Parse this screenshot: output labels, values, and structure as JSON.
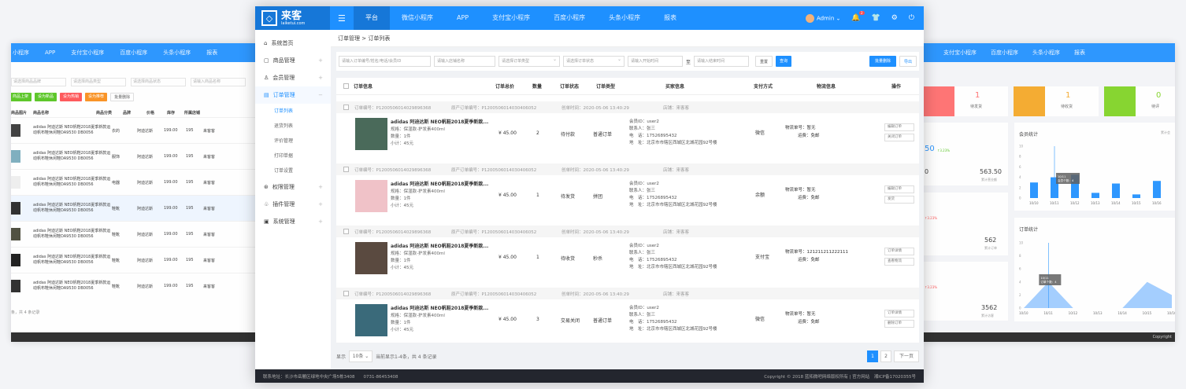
{
  "bg_left": {
    "nav": [
      "小程序",
      "APP",
      "支付宝小程序",
      "百度小程序",
      "头条小程序",
      "报表"
    ],
    "filters": [
      "请选择商品品牌",
      "请选择商品类型",
      "请选择商品状态",
      "请输入商品名称"
    ],
    "buttons": [
      {
        "label": "商品上架",
        "color": "#52c41a"
      },
      {
        "label": "设为新品",
        "color": "#52c41a"
      },
      {
        "label": "设为热销",
        "color": "#ff4d4f"
      },
      {
        "label": "设为推荐",
        "color": "#fa8c16"
      },
      {
        "label": "批量删除",
        "color": "#ffffff"
      }
    ],
    "headers": [
      "商品图片",
      "商品名称",
      "商品分类",
      "品牌",
      "价格",
      "库存",
      "所属店铺"
    ],
    "rows": [
      {
        "name": "adidas 阿迪达斯 NEO帆鞋2018夏季新款运动帆布鞋休闲鞋DA9530 DB0056",
        "cat": "衣的",
        "brand": "阿迪达斯",
        "price": "199.00",
        "stock": "195",
        "shop": "来客客"
      },
      {
        "name": "adidas 阿迪达斯 NEO帆鞋2018夏季新款运动帆布鞋休闲鞋DA9530 DB0056",
        "cat": "服饰",
        "brand": "阿迪达斯",
        "price": "199.00",
        "stock": "195",
        "shop": "来客客"
      },
      {
        "name": "adidas 阿迪达斯 NEO帆鞋2018夏季新款运动帆布鞋休闲鞋DA9530 DB0056",
        "cat": "电器",
        "brand": "阿迪达斯",
        "price": "199.00",
        "stock": "195",
        "shop": "来客客"
      },
      {
        "name": "adidas 阿迪达斯 NEO帆鞋2018夏季新款运动帆布鞋休闲鞋DA9530 DB0056",
        "cat": "鞋靴",
        "brand": "阿迪达斯",
        "price": "199.00",
        "stock": "195",
        "shop": "来客客"
      },
      {
        "name": "adidas 阿迪达斯 NEO帆鞋2018夏季新款运动帆布鞋休闲鞋DA9530 DB0056",
        "cat": "鞋靴",
        "brand": "阿迪达斯",
        "price": "199.00",
        "stock": "195",
        "shop": "来客客"
      },
      {
        "name": "adidas 阿迪达斯 NEO帆鞋2018夏季新款运动帆布鞋休闲鞋DA9530 DB0056",
        "cat": "鞋靴",
        "brand": "阿迪达斯",
        "price": "199.00",
        "stock": "195",
        "shop": "来客客"
      },
      {
        "name": "adidas 阿迪达斯 NEO帆鞋2018夏季新款运动帆布鞋休闲鞋DA9530 DB0056",
        "cat": "鞋靴",
        "brand": "阿迪达斯",
        "price": "199.00",
        "stock": "195",
        "shop": "来客客"
      }
    ],
    "footer": "条，共 4 条记录"
  },
  "bg_right": {
    "nav": [
      "支付宝小程序",
      "百度小程序",
      "头条小程序",
      "报表"
    ],
    "stats": [
      {
        "value": "1",
        "label": "待发货",
        "color": "#ff6b6b"
      },
      {
        "value": "1",
        "label": "待收货",
        "color": "#f5a623"
      },
      {
        "value": "0",
        "label": "待评",
        "color": "#7ed321"
      }
    ],
    "left_numbers": [
      "50",
      "0",
      "563.50",
      "累计营业额",
      "562",
      "累计订单",
      "3562",
      "累计访客"
    ],
    "chart1_title": "会员统计",
    "chart1_more": "累计会",
    "chart2_title": "订单统计",
    "tooltip1": [
      "10/11",
      "会员个数：4"
    ],
    "tooltip2": [
      "10/11",
      "订单个数：4"
    ],
    "chart1_y": [
      "10",
      "8",
      "6",
      "4",
      "2",
      "0"
    ],
    "chart2_y": [
      "10",
      "8",
      "6",
      "4",
      "2",
      "0"
    ],
    "footer": "Copyright"
  },
  "chart_data": [
    {
      "type": "bar",
      "title": "会员统计",
      "categories": [
        "10/10",
        "10/11",
        "10/12",
        "10/13",
        "10/14",
        "10/15",
        "10/16"
      ],
      "values": [
        3,
        4,
        4.5,
        1,
        2.8,
        0.7,
        3.3
      ],
      "ylim": [
        0,
        10
      ],
      "color": "#1e90ff"
    },
    {
      "type": "area",
      "title": "订单统计",
      "categories": [
        "10/10",
        "10/11",
        "10/12",
        "10/13",
        "10/14",
        "10/15",
        "10/16"
      ],
      "values": [
        0,
        4,
        0,
        0,
        0,
        4,
        2
      ],
      "ylim": [
        0,
        10
      ],
      "color": "#7db9ff"
    }
  ],
  "app": {
    "logo_main": "来客",
    "logo_sub": "laiketui.com",
    "tabs": [
      "平台",
      "微信小程序",
      "APP",
      "支付宝小程序",
      "百度小程序",
      "头条小程序",
      "报表"
    ],
    "active_tab": "平台",
    "user": "Admin",
    "notif_count": "2"
  },
  "sidebar": {
    "items": [
      {
        "label": "系统首页",
        "icon": "⌂",
        "plus": ""
      },
      {
        "label": "商品管理",
        "icon": "▢",
        "plus": "+"
      },
      {
        "label": "会员管理",
        "icon": "♙",
        "plus": "+"
      },
      {
        "label": "订单管理",
        "icon": "▤",
        "plus": "−"
      }
    ],
    "subs": [
      "订单列表",
      "退货列表",
      "评价管理",
      "打印单据",
      "订单设置"
    ],
    "items2": [
      {
        "label": "权限管理",
        "icon": "⊛",
        "plus": "+"
      },
      {
        "label": "插件管理",
        "icon": "♧",
        "plus": "+"
      },
      {
        "label": "系统管理",
        "icon": "▣",
        "plus": "+"
      }
    ]
  },
  "breadcrumb": "订单管理 > 订单列表",
  "filters": {
    "f1": "请输入订单编号/姓名/电话/会员ID",
    "f2": "请输入店铺名称",
    "f3": "请选择订单类型",
    "f4": "请选择订单状态",
    "f5": "请输入开始时间",
    "to": "至",
    "f6": "请输入结束时间",
    "reset": "重置",
    "search": "查询",
    "bulk_delete": "批量删除",
    "export": "导出"
  },
  "table_headers": [
    "订单信息",
    "订单总价",
    "数量",
    "订单状态",
    "订单类型",
    "买家信息",
    "支付方式",
    "物流信息",
    "操作"
  ],
  "orders": [
    {
      "no": "订单编号：P120050601402989​6368",
      "parent": "原产订单编号：P1200506014030406052",
      "time": "创单时间：2020-05-06 13:40:29",
      "shop": "店铺：来客客",
      "pname": "adidas 阿迪达斯 NEO帆鞋2018夏季新款...",
      "spec": "规格：保湿款-护发素400ml",
      "qty": "数量：1件",
      "sub": "小计：45元",
      "price": "¥ 45.00",
      "count": "2",
      "status": "待付款",
      "type": "普通订单",
      "member": "会员ID：user2",
      "contact": "联系人：张三",
      "phone": "电　话：17526895432",
      "addr": "地　址：北京市市辖区西城区北城花园92号楼",
      "pay": "微信",
      "logi1": "物流单号：暂无",
      "logi2": "运费：免邮",
      "act1": "编辑订单",
      "act2": "关闭订单",
      "thumb": "#4a6a5a"
    },
    {
      "no": "订单编号：P120050601402989​6368",
      "parent": "原产订单编号：P1200506014030406052",
      "time": "创单时间：2020-05-06 13:40:29",
      "shop": "店铺：来客客",
      "pname": "adidas 阿迪达斯 NEO帆鞋2018夏季新款...",
      "spec": "规格：保湿款-护发素400ml",
      "qty": "数量：1件",
      "sub": "小计：45元",
      "price": "¥ 45.00",
      "count": "1",
      "status": "待发货",
      "type": "拼团",
      "member": "会员ID：user2",
      "contact": "联系人：张三",
      "phone": "电　话：17526895432",
      "addr": "地　址：北京市市辖区西城区北城花园92号楼",
      "pay": "余额",
      "logi1": "物流单号：暂无",
      "logi2": "运费：免邮",
      "act1": "编辑订单",
      "act2": "发货",
      "thumb": "#f0c2c8"
    },
    {
      "no": "订单编号：P120050601402989​6368",
      "parent": "原产订单编号：P1200506014030406052",
      "time": "创单时间：2020-05-06 13:40:29",
      "shop": "店铺：来客客",
      "pname": "adidas 阿迪达斯 NEO帆鞋2018夏季新款...",
      "spec": "规格：保湿款-护发素400ml",
      "qty": "数量：1件",
      "sub": "小计：45元",
      "price": "¥ 45.00",
      "count": "1",
      "status": "待收货",
      "type": "秒杀",
      "member": "会员ID：user2",
      "contact": "联系人：张三",
      "phone": "电　话：17526895432",
      "addr": "地　址：北京市市辖区西城区北城花园92号楼",
      "pay": "支付宝",
      "logi1": "物流单号：121211211222111",
      "logi2": "运费：免邮",
      "act1": "订单详情",
      "act2": "查看物流",
      "thumb": "#5a4a40"
    },
    {
      "no": "订单编号：P120050601402989​6368",
      "parent": "原产订单编号：P1200506014030406052",
      "time": "创单时间：2020-05-06 13:40:29",
      "shop": "店铺：来客客",
      "pname": "adidas 阿迪达斯 NEO帆鞋2018夏季新款...",
      "spec": "规格：保湿款-护发素400ml",
      "qty": "数量：1件",
      "sub": "小计：45元",
      "price": "¥ 45.00",
      "count": "3",
      "status": "交易关闭",
      "type": "普通订单",
      "member": "会员ID：user2",
      "contact": "联系人：张三",
      "phone": "电　话：17526895432",
      "addr": "地　址：北京市市辖区西城区北城花园92号楼",
      "pay": "微信",
      "logi1": "物流单号：暂无",
      "logi2": "运费：免邮",
      "act1": "订单详情",
      "act2": "删除订单",
      "thumb": "#3a6a7a"
    }
  ],
  "pager": {
    "show": "显示",
    "size": "10条",
    "info": "当前显示1-4条，共 4 条记录",
    "pages": [
      "1",
      "2"
    ],
    "next": "下一页"
  },
  "footer": {
    "left": "联系地址：长沙市岳麓区绿地中央广场5栋3408　　0731-86453408",
    "right": "Copyright © 2018 蓝拓微吧网络版权所有 | 官方网站　湘ICP备17020355号"
  }
}
